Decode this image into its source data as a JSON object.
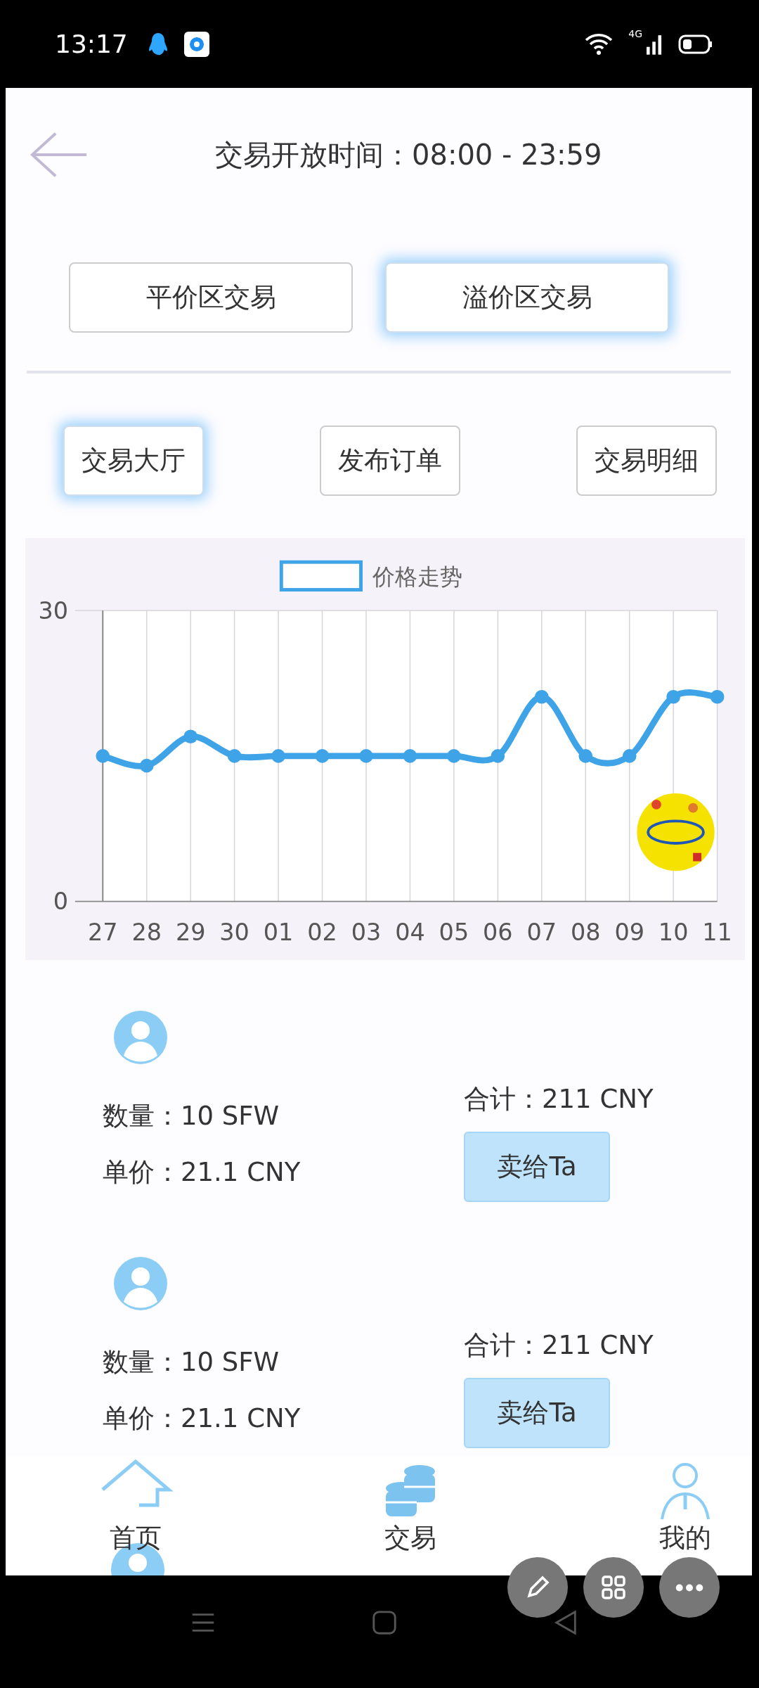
{
  "status_bar": {
    "time": "13:17",
    "network": "4G"
  },
  "header": {
    "title": "交易开放时间：08:00 - 23:59"
  },
  "zone_tabs": [
    {
      "label": "平价区交易",
      "selected": false
    },
    {
      "label": "溢价区交易",
      "selected": true
    }
  ],
  "sub_tabs": [
    {
      "label": "交易大厅",
      "selected": true
    },
    {
      "label": "发布订单",
      "selected": false
    },
    {
      "label": "交易明细",
      "selected": false
    }
  ],
  "chart": {
    "chart_data": {
      "type": "line",
      "categories": [
        "27",
        "28",
        "29",
        "30",
        "01",
        "02",
        "03",
        "04",
        "05",
        "06",
        "07",
        "08",
        "09",
        "10",
        "11"
      ],
      "series": [
        {
          "name": "价格走势",
          "color": "#3fa3e8",
          "values": [
            15,
            14,
            17,
            15,
            15,
            15,
            15,
            15,
            15,
            15,
            21.1,
            15,
            15,
            21.1,
            21.1
          ]
        }
      ],
      "ylim": [
        0,
        30
      ],
      "yticks": [
        0,
        30
      ],
      "grid": true,
      "marker": true
    }
  },
  "listings": [
    {
      "quantity": "数量：10 SFW",
      "unit_price": "单价：21.1 CNY",
      "total": "合计：211 CNY",
      "button": "卖给Ta"
    },
    {
      "quantity": "数量：10 SFW",
      "unit_price": "单价：21.1 CNY",
      "total": "合计：211 CNY",
      "button": "卖给Ta"
    }
  ],
  "bottom_nav": [
    {
      "label": "首页"
    },
    {
      "label": "交易"
    },
    {
      "label": "我的"
    }
  ]
}
